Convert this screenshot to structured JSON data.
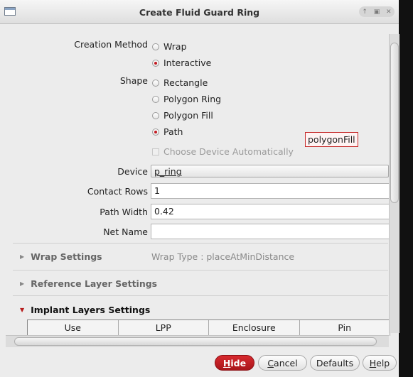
{
  "window": {
    "title": "Create Fluid Guard Ring",
    "controls": [
      "↑",
      "▣",
      "✕"
    ]
  },
  "form": {
    "creation_method": {
      "label": "Creation Method",
      "options": [
        "Wrap",
        "Interactive"
      ],
      "selected": "Interactive"
    },
    "shape": {
      "label": "Shape",
      "options": [
        "Rectangle",
        "Polygon Ring",
        "Polygon Fill",
        "Path"
      ],
      "selected": "Path"
    },
    "tooltip": "polygonFill",
    "choose_device_auto": "Choose Device Automatically",
    "device": {
      "label": "Device",
      "value": "p_ring"
    },
    "contact_rows": {
      "label": "Contact Rows",
      "value": "1"
    },
    "path_width": {
      "label": "Path Width",
      "value": "0.42"
    },
    "net_name": {
      "label": "Net Name",
      "value": ""
    }
  },
  "sections": {
    "wrap": {
      "label": "Wrap Settings",
      "info": "Wrap Type : placeAtMinDistance"
    },
    "reference": {
      "label": "Reference Layer Settings"
    },
    "implant": {
      "label": "Implant Layers Settings"
    }
  },
  "table": {
    "columns": [
      "Use",
      "LPP",
      "Enclosure",
      "Pin"
    ]
  },
  "buttons": {
    "hide": {
      "label": "Hide",
      "mnemonic": "H",
      "rest": "ide"
    },
    "cancel": {
      "label": "Cancel",
      "mnemonic": "C",
      "rest": "ancel"
    },
    "defaults": {
      "label": "Defaults"
    },
    "help": {
      "label": "Help",
      "mnemonic": "H",
      "rest": "elp"
    }
  },
  "icons": {
    "window": "window-icon",
    "expand_collapsed": "triangle-right-icon",
    "expand_open": "triangle-down-icon"
  },
  "colors": {
    "accent": "#c31a21",
    "background": "#ececec",
    "tooltip_border": "#c52a2a"
  }
}
